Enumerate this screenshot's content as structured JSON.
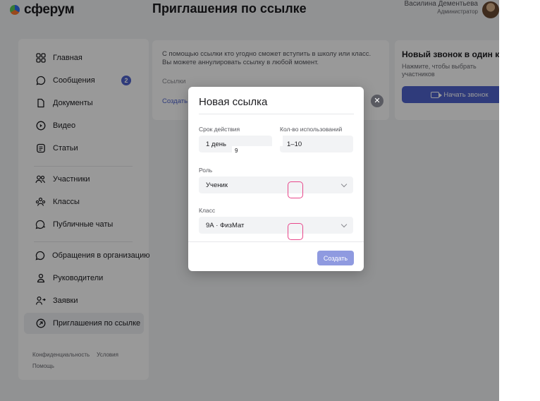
{
  "app": {
    "logo_text": "сферум",
    "page_title": "Приглашения по ссылке",
    "user_name": "Василина Дементьева",
    "user_role": "Администратор"
  },
  "sidebar": {
    "items": [
      {
        "label": "Главная",
        "icon": "grid-icon"
      },
      {
        "label": "Сообщения",
        "icon": "chat-icon",
        "badge": "2"
      },
      {
        "label": "Документы",
        "icon": "document-icon"
      },
      {
        "label": "Видео",
        "icon": "play-icon"
      },
      {
        "label": "Статьи",
        "icon": "article-icon"
      },
      {
        "label": "Участники",
        "icon": "people-icon"
      },
      {
        "label": "Классы",
        "icon": "group-icon"
      },
      {
        "label": "Публичные чаты",
        "icon": "public-chat-icon"
      },
      {
        "label": "Обращения в организацию",
        "icon": "chat-icon"
      },
      {
        "label": "Руководители",
        "icon": "person-icon"
      },
      {
        "label": "Заявки",
        "icon": "person-arrow-icon"
      },
      {
        "label": "Приглашения по ссылке",
        "icon": "link-icon"
      }
    ],
    "footer": {
      "privacy": "Конфиденциальность",
      "terms": "Условия",
      "help": "Помощь"
    }
  },
  "info_card": {
    "text": "С помощью ссылки кто угодно сможет вступить в школу или класс. Вы можете аннулировать ссылку в любой момент.",
    "links_label": "Ссылки",
    "create_link": "Создать"
  },
  "call_card": {
    "title": "Новый звонок в один клик",
    "subtitle": "Нажмите, чтобы выбрать участников",
    "button": "Начать звонок"
  },
  "modal": {
    "title": "Новая ссылка",
    "duration_label": "Срок действия",
    "duration_value": "1 день",
    "duration_extra": "9",
    "uses_label": "Кол-во использований",
    "uses_value": "1–10",
    "role_label": "Роль",
    "role_value": "Ученик",
    "class_label": "Класс",
    "class_value": "9А · ФизМат",
    "create_button": "Создать",
    "close_symbol": "✕"
  },
  "colors": {
    "accent": "#4f63ce",
    "marker": "#e8478b",
    "background": "#f2f3f5"
  }
}
